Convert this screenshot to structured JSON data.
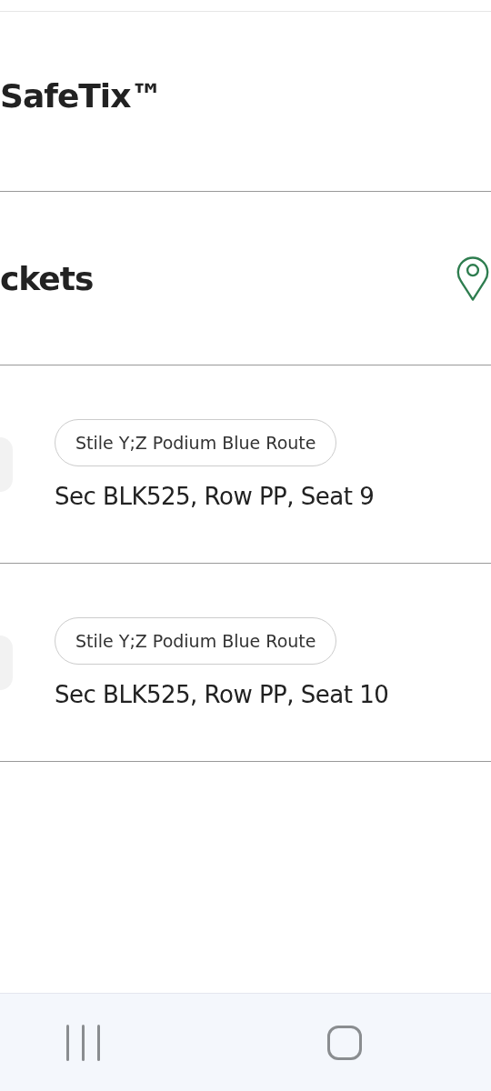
{
  "header": {
    "title": "SafeTix™"
  },
  "section": {
    "title": "ckets"
  },
  "tickets": [
    {
      "entrance": "Stile Y;Z Podium Blue Route",
      "seat": "Sec BLK525, Row PP, Seat 9"
    },
    {
      "entrance": "Stile Y;Z Podium Blue Route",
      "seat": "Sec BLK525, Row PP, Seat 10"
    }
  ]
}
